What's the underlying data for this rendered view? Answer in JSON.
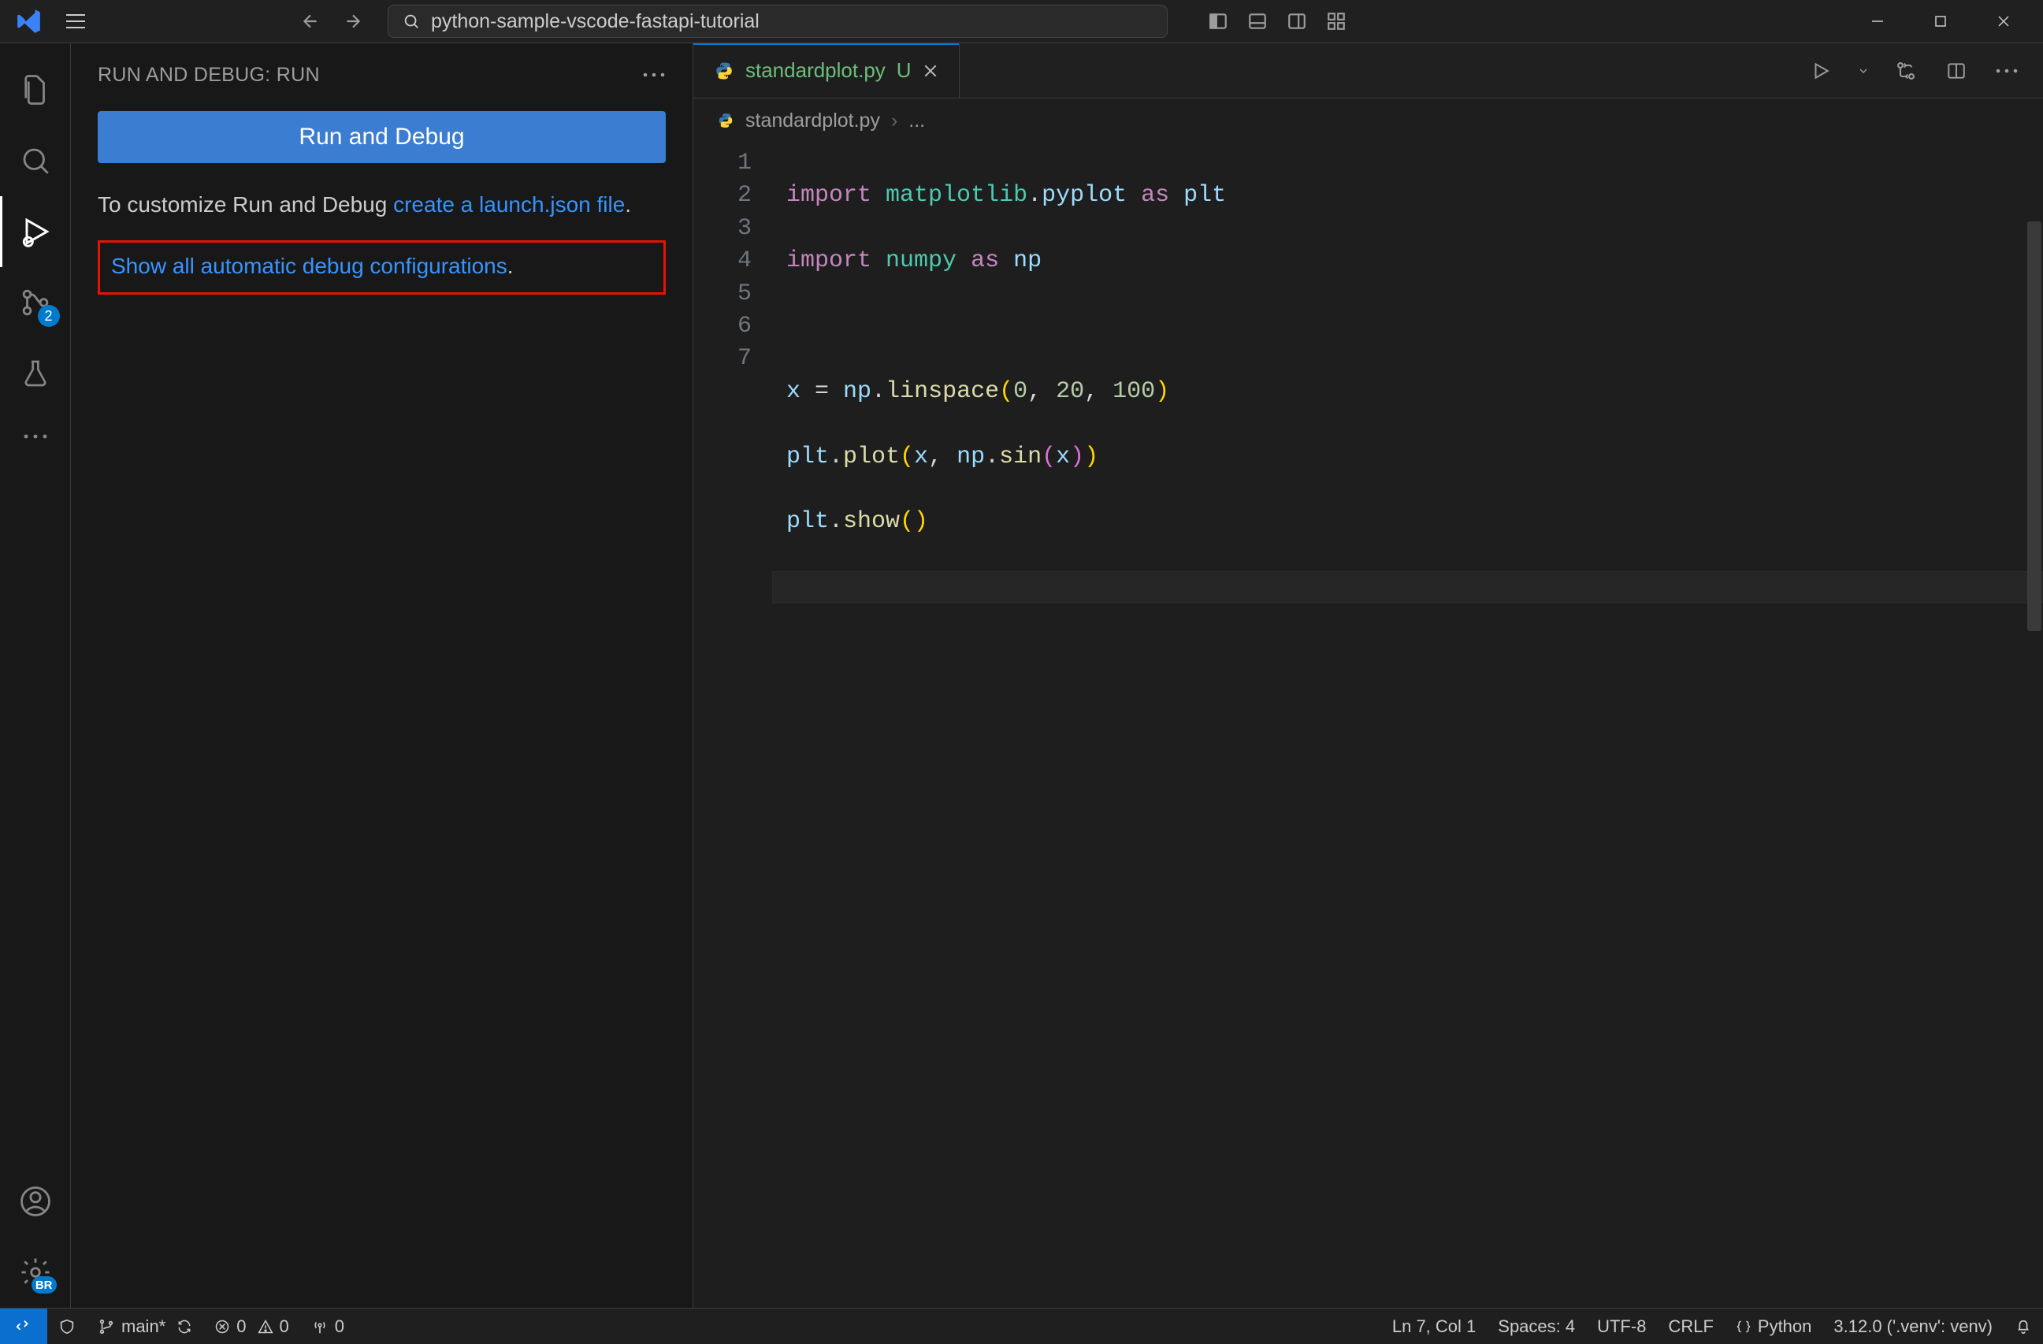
{
  "titlebar": {
    "workspace_name": "python-sample-vscode-fastapi-tutorial"
  },
  "activitybar": {
    "source_control_badge": "2",
    "settings_badge": "BR"
  },
  "sidepanel": {
    "header": "RUN AND DEBUG: RUN",
    "run_button": "Run and Debug",
    "customize_text": "To customize Run and Debug ",
    "create_launch_link": "create a launch.json file",
    "show_all_link": "Show all automatic debug configurations",
    "period": "."
  },
  "tabs": {
    "file_name": "standardplot.py",
    "modified_indicator": "U"
  },
  "breadcrumb": {
    "file": "standardplot.py",
    "rest": "..."
  },
  "editor": {
    "lines": [
      "1",
      "2",
      "3",
      "4",
      "5",
      "6",
      "7"
    ]
  },
  "statusbar": {
    "branch": "main*",
    "errors": "0",
    "warnings": "0",
    "ports": "0",
    "cursor": "Ln 7, Col 1",
    "spaces": "Spaces: 4",
    "encoding": "UTF-8",
    "eol": "CRLF",
    "lang": "Python",
    "interpreter": "3.12.0 ('.venv': venv)"
  }
}
